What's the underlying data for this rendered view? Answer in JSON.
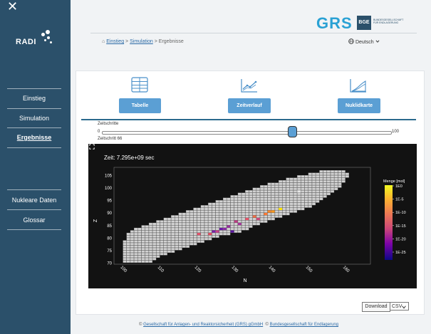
{
  "sidebar": {
    "close_glyph": "✕",
    "logo_text": "RADI",
    "items": [
      {
        "label": "Einstieg",
        "active": false
      },
      {
        "label": "Simulation",
        "active": false
      },
      {
        "label": "Ergebnisse",
        "active": true
      },
      {
        "label": "Nukleare Daten",
        "active": false
      },
      {
        "label": "Glossar",
        "active": false
      }
    ]
  },
  "header": {
    "grs_logo": "GRS",
    "bge_logo": "BGE",
    "bge_text": "BUNDESGESELLSCHAFT FÜR ENDLAGERUNG",
    "breadcrumb": {
      "home_icon": "⌂",
      "home": "Einstieg",
      "sep": ">",
      "sim": "Simulation",
      "current": "Ergebnisse"
    },
    "language": "Deutsch"
  },
  "views": [
    {
      "label": "Tabelle",
      "icon": "table-icon"
    },
    {
      "label": "Zeitverlauf",
      "icon": "line-chart-icon"
    },
    {
      "label": "Nuklidkarte",
      "icon": "area-chart-icon"
    }
  ],
  "slider": {
    "label": "Zeitschritte",
    "min": "0",
    "max": "100",
    "value": 66,
    "value_label": "Zeitschritt 66"
  },
  "chart_data": {
    "type": "heatmap",
    "title": "Zeit: 7.295e+09 sec",
    "xlabel": "N",
    "ylabel": "Z",
    "x_ticks": [
      "100",
      "110",
      "120",
      "130",
      "140",
      "150",
      "160"
    ],
    "y_ticks": [
      "70",
      "75",
      "80",
      "85",
      "90",
      "95",
      "100",
      "105"
    ],
    "xlim": [
      98,
      166
    ],
    "ylim": [
      70,
      107
    ],
    "colorbar": {
      "label": "Menge [mol]",
      "ticks": [
        "1E0",
        "1E-5",
        "1E-10",
        "1E-15",
        "1E-20",
        "1E-25"
      ]
    },
    "band": [
      {
        "z": 70,
        "n0": 100,
        "n1": 107
      },
      {
        "z": 71,
        "n0": 100,
        "n1": 108
      },
      {
        "z": 72,
        "n0": 100,
        "n1": 109
      },
      {
        "z": 73,
        "n0": 100,
        "n1": 111
      },
      {
        "z": 74,
        "n0": 100,
        "n1": 113
      },
      {
        "z": 75,
        "n0": 100,
        "n1": 115
      },
      {
        "z": 76,
        "n0": 100,
        "n1": 117
      },
      {
        "z": 77,
        "n0": 100,
        "n1": 119
      },
      {
        "z": 78,
        "n0": 100,
        "n1": 121
      },
      {
        "z": 79,
        "n0": 101,
        "n1": 123
      },
      {
        "z": 80,
        "n0": 101,
        "n1": 125
      },
      {
        "z": 81,
        "n0": 101,
        "n1": 128
      },
      {
        "z": 82,
        "n0": 102,
        "n1": 131
      },
      {
        "z": 83,
        "n0": 103,
        "n1": 133
      },
      {
        "z": 84,
        "n0": 105,
        "n1": 134
      },
      {
        "z": 85,
        "n0": 107,
        "n1": 136
      },
      {
        "z": 86,
        "n0": 109,
        "n1": 138
      },
      {
        "z": 87,
        "n0": 111,
        "n1": 140
      },
      {
        "z": 88,
        "n0": 113,
        "n1": 142
      },
      {
        "z": 89,
        "n0": 115,
        "n1": 144
      },
      {
        "z": 90,
        "n0": 117,
        "n1": 146
      },
      {
        "z": 91,
        "n0": 119,
        "n1": 148
      },
      {
        "z": 92,
        "n0": 121,
        "n1": 150
      },
      {
        "z": 93,
        "n0": 123,
        "n1": 151
      },
      {
        "z": 94,
        "n0": 125,
        "n1": 152
      },
      {
        "z": 95,
        "n0": 127,
        "n1": 153
      },
      {
        "z": 96,
        "n0": 129,
        "n1": 154
      },
      {
        "z": 97,
        "n0": 131,
        "n1": 155
      },
      {
        "z": 98,
        "n0": 133,
        "n1": 156
      },
      {
        "z": 99,
        "n0": 135,
        "n1": 157
      },
      {
        "z": 100,
        "n0": 137,
        "n1": 158
      },
      {
        "z": 101,
        "n0": 139,
        "n1": 158
      },
      {
        "z": 102,
        "n0": 142,
        "n1": 159
      },
      {
        "z": 103,
        "n0": 144,
        "n1": 159
      },
      {
        "z": 104,
        "n0": 147,
        "n1": 160
      },
      {
        "z": 105,
        "n0": 150,
        "n1": 160
      },
      {
        "z": 106,
        "n0": 153,
        "n1": 159
      }
    ],
    "highlights": [
      {
        "n": 142,
        "z": 91,
        "color": "#ffe600"
      },
      {
        "n": 140,
        "z": 90,
        "color": "#ff9a1e"
      },
      {
        "n": 138,
        "z": 89,
        "color": "#ff7a33"
      },
      {
        "n": 139,
        "z": 90,
        "color": "#ff8a2a"
      },
      {
        "n": 135,
        "z": 88,
        "color": "#f26d46"
      },
      {
        "n": 133,
        "z": 87,
        "color": "#e8546a"
      },
      {
        "n": 136,
        "z": 87,
        "color": "#d0487a"
      },
      {
        "n": 130,
        "z": 86,
        "color": "#bf3d86"
      },
      {
        "n": 131,
        "z": 85,
        "color": "#a8359a"
      },
      {
        "n": 128,
        "z": 84,
        "color": "#9a2fa0"
      },
      {
        "n": 127,
        "z": 83,
        "color": "#8a27a6"
      },
      {
        "n": 124,
        "z": 82,
        "color": "#7a1fa8"
      },
      {
        "n": 126,
        "z": 83,
        "color": "#6a18a4"
      },
      {
        "n": 123,
        "z": 81,
        "color": "#e64d60"
      },
      {
        "n": 125,
        "z": 82,
        "color": "#c7408c"
      },
      {
        "n": 129,
        "z": 82,
        "color": "#5a14a0"
      },
      {
        "n": 120,
        "z": 81,
        "color": "#e3506a"
      },
      {
        "n": 147,
        "z": 98,
        "color": "#e8e8e8"
      }
    ]
  },
  "download": {
    "label": "Download",
    "format": "CSV"
  },
  "footer": {
    "prefix": "© ",
    "grs": "Gesellschaft für Anlagen- und Reaktorsicherheit (GRS) gGmbH",
    "middle": "  © ",
    "bge": "Bundesgesellschaft für Endlagerung"
  }
}
